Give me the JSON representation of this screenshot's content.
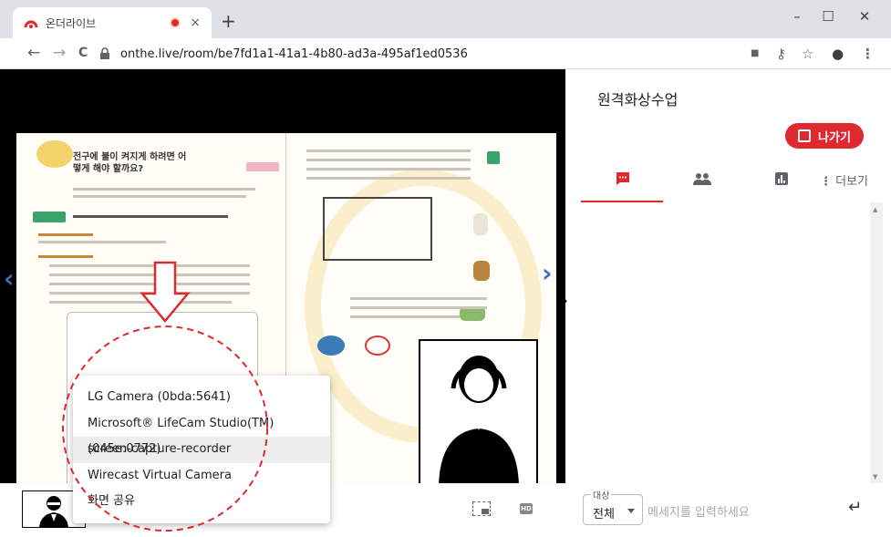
{
  "browser": {
    "tab_title": "온더라이브",
    "tab_close": "×",
    "new_tab": "+",
    "url": "onthe.live/room/be7fd1a1-41a1-4b80-ad3a-495af1ed0536",
    "window_controls": {
      "minimize": "–",
      "maximize": "☐",
      "close": "✕"
    },
    "nav": {
      "back": "←",
      "forward": "→",
      "reload": "C"
    },
    "toolbar_icons": {
      "camera": "■",
      "key": "⚷",
      "star": "☆",
      "account": "●",
      "menu": "⋮"
    }
  },
  "stage": {
    "lesson_title": "전구에 불이 켜지게 하려면 어떻게 해야 할까요?",
    "prev_page": "‹",
    "next_page": "›",
    "pip_label": "",
    "hd_label": "HD"
  },
  "device_menu": {
    "items": [
      {
        "label": "LG Camera (0bda:5641)",
        "highlighted": false
      },
      {
        "label": "Microsoft® LifeCam Studio(TM) (045e:0772)",
        "highlighted": false
      },
      {
        "label": "screen-capture-recorder",
        "highlighted": true
      },
      {
        "label": "Wirecast Virtual Camera",
        "highlighted": false
      },
      {
        "label": "화면 공유",
        "highlighted": false
      }
    ]
  },
  "panel": {
    "title": "원격화상수업",
    "exit_button": "나가기",
    "tabs": [
      {
        "name": "chat",
        "icon": "chat-icon",
        "active": true
      },
      {
        "name": "participants",
        "icon": "people-icon",
        "active": false
      },
      {
        "name": "stats",
        "icon": "chart-icon",
        "active": false
      }
    ],
    "more_label": "더보기",
    "target_label": "대상",
    "target_value": "전체",
    "message_placeholder": "메세지를 입력하세요",
    "send_icon": "↵"
  },
  "drawer_toggle": "›",
  "colors": {
    "accent": "#e0292f",
    "stage_bg": "#000000",
    "annotation": "#e0292f"
  }
}
